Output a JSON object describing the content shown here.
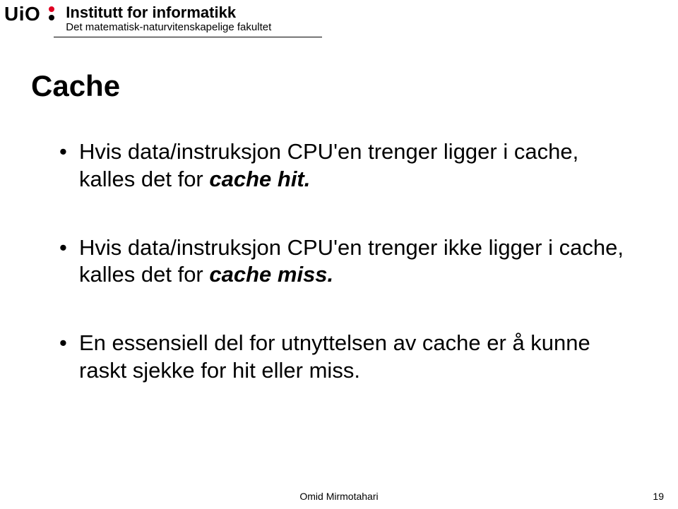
{
  "header": {
    "uio": "UiO",
    "institute": "Institutt for informatikk",
    "faculty": "Det matematisk-naturvitenskapelige fakultet"
  },
  "slide": {
    "title": "Cache",
    "bullets": [
      {
        "pre": "Hvis data/instruksjon CPU'en trenger ligger i cache, kalles det for ",
        "em": "cache hit.",
        "post": ""
      },
      {
        "pre": "Hvis data/instruksjon CPU'en trenger ikke ligger i cache, kalles det for ",
        "em": "cache miss.",
        "post": ""
      },
      {
        "pre": "En essensiell del for utnyttelsen av cache er å kunne raskt sjekke for hit eller miss.",
        "em": "",
        "post": ""
      }
    ]
  },
  "footer": {
    "author": "Omid Mirmotahari",
    "page": "19"
  }
}
